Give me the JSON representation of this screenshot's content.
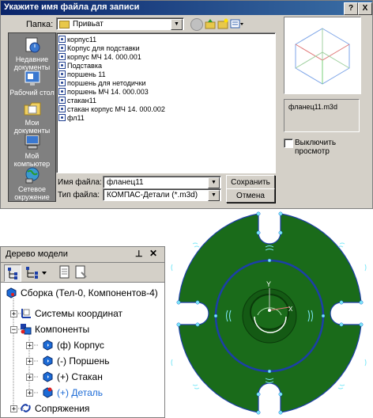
{
  "dialog": {
    "title": "Укажите имя файла для записи",
    "help_btn": "?",
    "close_btn": "X",
    "folder_label": "Папка:",
    "folder_value": "Привьат",
    "places": [
      {
        "label": "Недавние документы",
        "icon": "recent-docs-icon"
      },
      {
        "label": "Рабочий стол",
        "icon": "desktop-icon"
      },
      {
        "label": "Мои документы",
        "icon": "my-documents-icon"
      },
      {
        "label": "Мой компьютер",
        "icon": "my-computer-icon"
      },
      {
        "label": "Сетевое окружение",
        "icon": "network-icon"
      }
    ],
    "files": [
      "корпус11",
      "Корпус для подставки",
      "корпус МЧ 14. 000.001",
      "Подставка",
      "поршень 11",
      "поршень для нетодички",
      "поршень МЧ 14. 000.003",
      "стакан11",
      "стакан корпус МЧ 14. 000.002",
      "фл11"
    ],
    "filename_label": "Имя файла:",
    "filename_value": "фланец11",
    "filetype_label": "Тип файла:",
    "filetype_value": "КОМПАС-Детали (*.m3d)",
    "save_btn": "Сохранить",
    "cancel_btn": "Отмена",
    "preview_name": "фланец11.m3d",
    "preview_toggle": "Выключить просмотр"
  },
  "tree": {
    "title": "Дерево модели",
    "pin": "⊥",
    "close": "✕",
    "root": "Сборка (Тел-0, Компонентов-4)",
    "items": [
      {
        "label": "Системы координат",
        "sign": "+"
      },
      {
        "label": "Компоненты",
        "sign": "−"
      },
      {
        "label": "(ф) Корпус",
        "sign": "+"
      },
      {
        "label": "(-) Поршень",
        "sign": "+"
      },
      {
        "label": "(+) Стакан",
        "sign": "+"
      },
      {
        "label": "(+) Деталь",
        "sign": "+"
      },
      {
        "label": "Сопряжения",
        "sign": "+"
      }
    ]
  },
  "colors": {
    "title_bar": "#0a246a",
    "part_fill": "#1a6b1a",
    "part_edge": "#1c3fa8",
    "highlight": "#1c6bd6"
  }
}
